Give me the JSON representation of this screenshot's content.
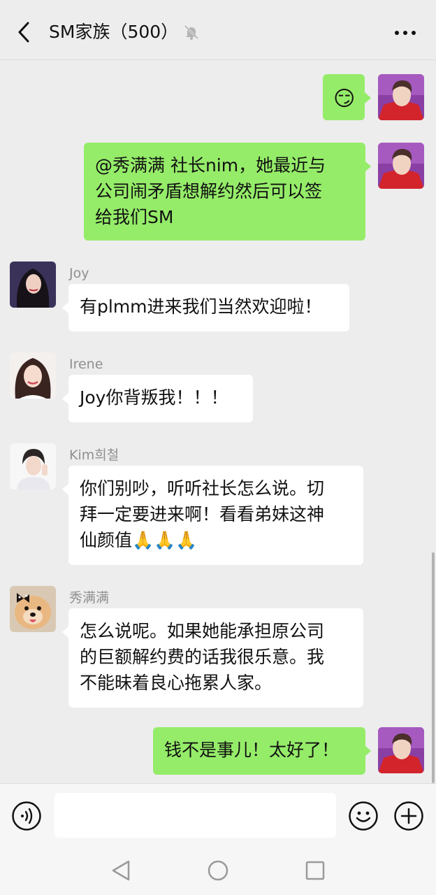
{
  "header": {
    "title": "SM家族（500）"
  },
  "messages": [
    {
      "direction": "out",
      "sender": "",
      "text": "😏",
      "avatar": "user-avatar"
    },
    {
      "direction": "out",
      "sender": "",
      "lines": [
        "@秀满满 社长nim，她最近与",
        "公司闹矛盾想解约然后可以签",
        "给我们SM"
      ],
      "avatar": "user-avatar"
    },
    {
      "direction": "in",
      "sender": "Joy",
      "lines": [
        "有plmm进来我们当然欢迎啦！"
      ],
      "avatar": "joy-avatar"
    },
    {
      "direction": "in",
      "sender": "Irene",
      "lines": [
        "Joy你背叛我！！！"
      ],
      "avatar": "irene-avatar"
    },
    {
      "direction": "in",
      "sender": "Kim희철",
      "lines": [
        "你们别吵，听听社长怎么说。切",
        "拜一定要进来啊！看看弟妹这神",
        "仙颜值🙏🙏🙏"
      ],
      "avatar": "kim-avatar"
    },
    {
      "direction": "in",
      "sender": "秀满满",
      "lines": [
        "怎么说呢。如果她能承担原公司",
        "的巨额解约费的话我很乐意。我",
        "不能昧着良心拖累人家。"
      ],
      "avatar": "dog-avatar"
    },
    {
      "direction": "out",
      "sender": "",
      "lines": [
        "钱不是事儿！太好了！"
      ],
      "avatar": "user-avatar"
    }
  ],
  "input": {
    "placeholder": ""
  },
  "colors": {
    "background": "#ededed",
    "outgoing_bubble": "#95ec69",
    "incoming_bubble": "#ffffff",
    "sender_name": "#8f8f8f"
  },
  "icons": {
    "back": "chevron-left-icon",
    "mute": "bell-muted-icon",
    "more": "more-dots-icon",
    "voice": "voice-icon",
    "emoji": "smiley-icon",
    "plus": "plus-circle-icon",
    "nav_back": "triangle-back-icon",
    "nav_home": "circle-home-icon",
    "nav_recent": "square-recent-icon"
  }
}
